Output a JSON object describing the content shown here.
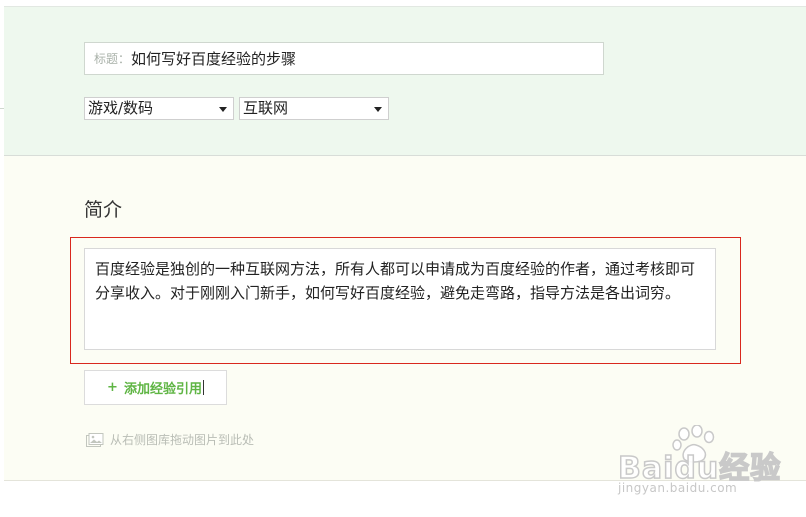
{
  "title_field": {
    "label": "标题：",
    "value": "如何写好百度经验的步骤"
  },
  "category": {
    "primary_selected": "游戏/数码",
    "secondary_selected": "互联网"
  },
  "intro": {
    "heading": "简介",
    "text": "百度经验是独创的一种互联网方法，所有人都可以申请成为百度经验的作者，通过考核即可分享收入。对于刚刚入门新手，如何写好百度经验，避免走弯路，指导方法是各出词穷。"
  },
  "add_reference": {
    "plus": "+",
    "label": "添加经验引用"
  },
  "image_hint": {
    "icon": "image-icon",
    "text": "从右侧图库拖动图片到此处"
  },
  "watermark": {
    "logo_text": "Baidu经验",
    "url": "jingyan.baidu.com"
  },
  "colors": {
    "top_bg": "#eef8ee",
    "bottom_bg": "#fcfdf4",
    "highlight_border": "#d9281d",
    "accent_green": "#5fb544"
  }
}
